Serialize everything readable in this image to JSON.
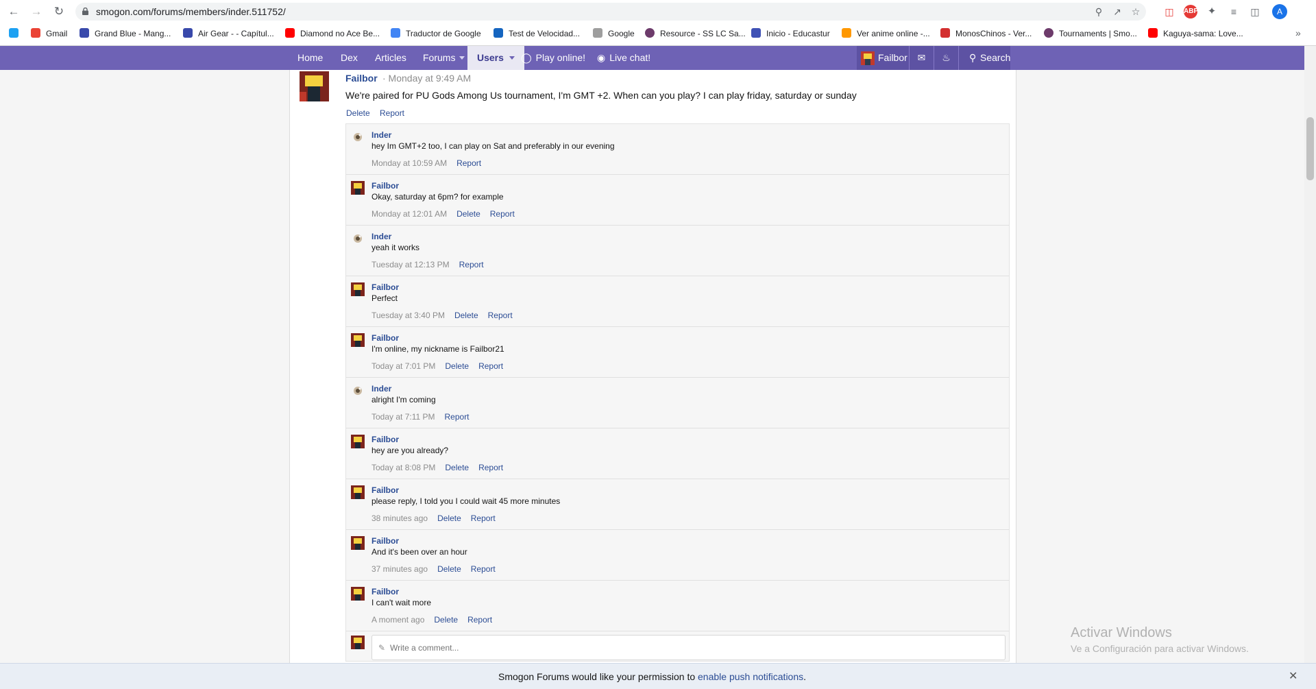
{
  "browser": {
    "url": "smogon.com/forums/members/inder.511752/",
    "bookmarks": [
      {
        "label": "Gmail",
        "color": "#ea4335"
      },
      {
        "label": "Grand Blue - Mang...",
        "color": "#3949ab"
      },
      {
        "label": "Air Gear - - Capítul...",
        "color": "#3949ab"
      },
      {
        "label": "Diamond no Ace Be...",
        "color": "#ff0000"
      },
      {
        "label": "Traductor de Google",
        "color": "#4285f4"
      },
      {
        "label": "Test de Velocidad...",
        "color": "#1565c0"
      },
      {
        "label": "Google",
        "color": "#9e9e9e"
      },
      {
        "label": "Resource - SS LC Sa...",
        "color": "#6d3b6b"
      },
      {
        "label": "Inicio - Educastur",
        "color": "#3f51b5"
      },
      {
        "label": "Ver anime online -...",
        "color": "#ff9800"
      },
      {
        "label": "MonosChinos - Ver...",
        "color": "#d32f2f"
      },
      {
        "label": "Tournaments | Smo...",
        "color": "#6d3b6b"
      },
      {
        "label": "Kaguya-sama: Love...",
        "color": "#ff0000"
      }
    ],
    "profile_initial": "A",
    "more_bookmarks": "»"
  },
  "site_nav": {
    "items": [
      "Home",
      "Dex",
      "Articles",
      "Forums",
      "Users",
      "Play online!",
      "Live chat!"
    ],
    "user_name": "Failbor",
    "search_label": "Search"
  },
  "profile_post": {
    "author": "Failbor",
    "meta": "· Monday at 9:49 AM",
    "text": "We're paired for PU Gods Among Us tournament, I'm GMT +2. When can you play? I can play friday, saturday or sunday",
    "delete_label": "Delete",
    "report_label": "Report"
  },
  "comments": [
    {
      "author": "Inder",
      "text": "hey Im GMT+2 too, I can play on Sat and preferably in our evening",
      "time": "Monday at 10:59 AM",
      "can_delete": false
    },
    {
      "author": "Failbor",
      "text": "Okay, saturday at 6pm? for example",
      "time": "Monday at 12:01 AM",
      "can_delete": true
    },
    {
      "author": "Inder",
      "text": "yeah it works",
      "time": "Tuesday at 12:13 PM",
      "can_delete": false
    },
    {
      "author": "Failbor",
      "text": "Perfect",
      "time": "Tuesday at 3:40 PM",
      "can_delete": true
    },
    {
      "author": "Failbor",
      "text": "I'm online, my nickname is Failbor21",
      "time": "Today at 7:01 PM",
      "can_delete": true
    },
    {
      "author": "Inder",
      "text": "alright I'm coming",
      "time": "Today at 7:11 PM",
      "can_delete": false
    },
    {
      "author": "Failbor",
      "text": "hey are you already?",
      "time": "Today at 8:08 PM",
      "can_delete": true
    },
    {
      "author": "Failbor",
      "text": "please reply, I told you I could wait 45 more minutes",
      "time": "38 minutes ago",
      "can_delete": true
    },
    {
      "author": "Failbor",
      "text": "And it's been over an hour",
      "time": "37 minutes ago",
      "can_delete": true
    },
    {
      "author": "Failbor",
      "text": "I can't wait more",
      "time": "A moment ago",
      "can_delete": true
    }
  ],
  "comment_labels": {
    "delete": "Delete",
    "report": "Report"
  },
  "reply": {
    "placeholder": "Write a comment..."
  },
  "watermark": {
    "title": "Activar Windows",
    "subtitle": "Ve a Configuración para activar Windows."
  },
  "push_bar": {
    "text": "Smogon Forums would like your permission to ",
    "link": "enable push notifications",
    "suffix": "."
  }
}
